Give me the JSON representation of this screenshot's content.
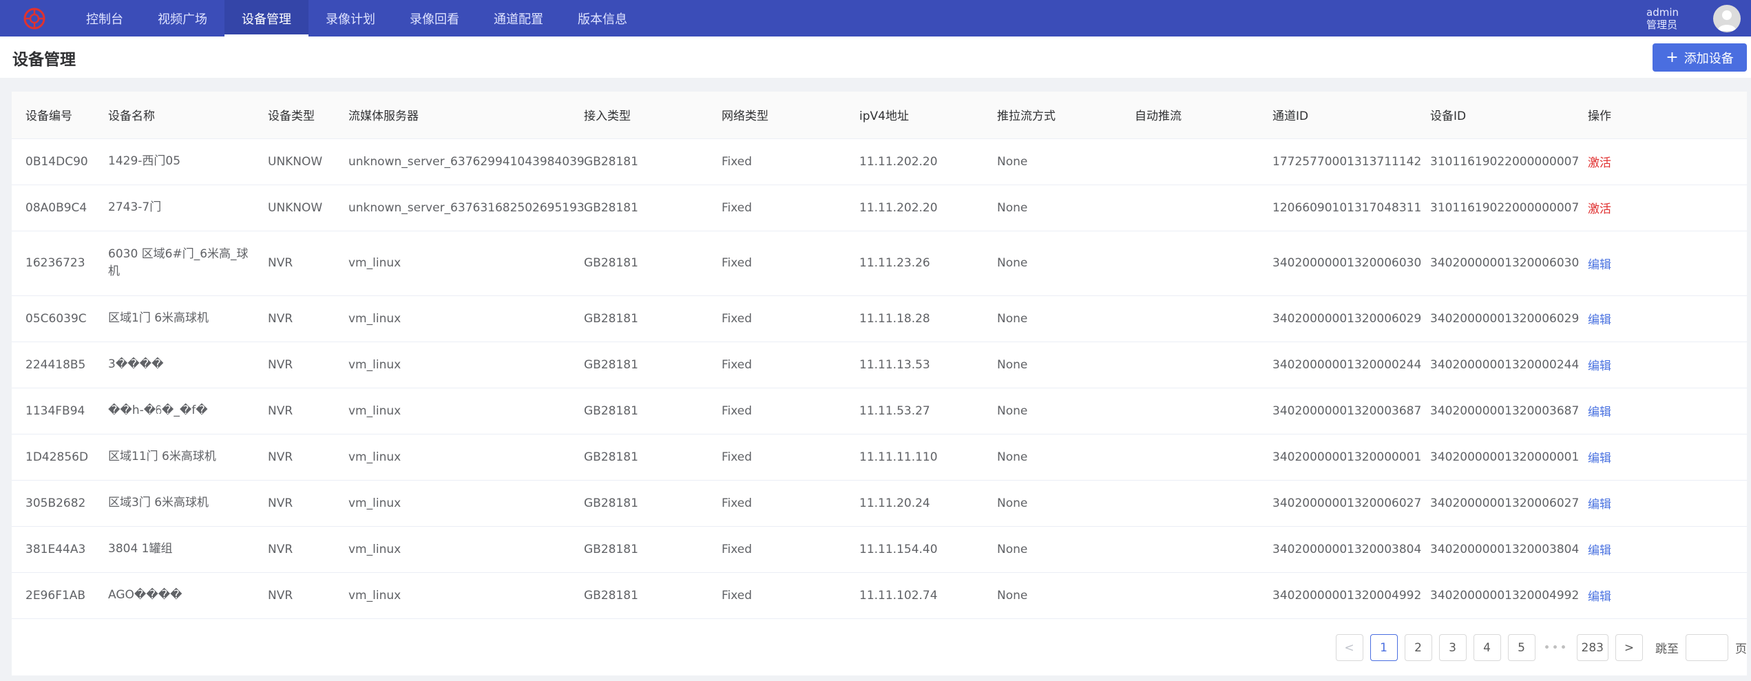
{
  "nav": {
    "items": [
      {
        "label": "控制台"
      },
      {
        "label": "视频广场"
      },
      {
        "label": "设备管理"
      },
      {
        "label": "录像计划"
      },
      {
        "label": "录像回看"
      },
      {
        "label": "通道配置"
      },
      {
        "label": "版本信息"
      }
    ],
    "active_index": 2
  },
  "user": {
    "name": "admin",
    "role": "管理员"
  },
  "page": {
    "title": "设备管理",
    "add_button": "添加设备"
  },
  "table": {
    "columns": [
      "设备编号",
      "设备名称",
      "设备类型",
      "流媒体服务器",
      "接入类型",
      "网络类型",
      "ipV4地址",
      "推拉流方式",
      "自动推流",
      "通道ID",
      "设备ID",
      "操作"
    ],
    "rows": [
      {
        "code": "0B14DC90",
        "name": "1429-西门05",
        "type": "UNKNOW",
        "server": "unknown_server_637629941043984039",
        "access": "GB28181",
        "net": "Fixed",
        "ip": "11.11.202.20",
        "mode": "None",
        "auto": "",
        "channel": "17725770001313711142",
        "device": "31011619022000000007",
        "action": "激活",
        "action_color": "#e02f2f"
      },
      {
        "code": "08A0B9C4",
        "name": "2743-7门",
        "type": "UNKNOW",
        "server": "unknown_server_637631682502695193",
        "access": "GB28181",
        "net": "Fixed",
        "ip": "11.11.202.20",
        "mode": "None",
        "auto": "",
        "channel": "12066090101317048311",
        "device": "31011619022000000007",
        "action": "激活",
        "action_color": "#e02f2f"
      },
      {
        "code": "16236723",
        "name": "6030 区域6#门_6米高_球机",
        "type": "NVR",
        "server": "vm_linux",
        "access": "GB28181",
        "net": "Fixed",
        "ip": "11.11.23.26",
        "mode": "None",
        "auto": "",
        "channel": "34020000001320006030",
        "device": "34020000001320006030",
        "action": "编辑",
        "action_color": "#4a72e0"
      },
      {
        "code": "05C6039C",
        "name": "区域1门 6米高球机",
        "type": "NVR",
        "server": "vm_linux",
        "access": "GB28181",
        "net": "Fixed",
        "ip": "11.11.18.28",
        "mode": "None",
        "auto": "",
        "channel": "34020000001320006029",
        "device": "34020000001320006029",
        "action": "编辑",
        "action_color": "#4a72e0"
      },
      {
        "code": "224418B5",
        "name": "3����",
        "type": "NVR",
        "server": "vm_linux",
        "access": "GB28181",
        "net": "Fixed",
        "ip": "11.11.13.53",
        "mode": "None",
        "auto": "",
        "channel": "34020000001320000244",
        "device": "34020000001320000244",
        "action": "编辑",
        "action_color": "#4a72e0"
      },
      {
        "code": "1134FB94",
        "name": "��h-�ᦆ�_�f�",
        "type": "NVR",
        "server": "vm_linux",
        "access": "GB28181",
        "net": "Fixed",
        "ip": "11.11.53.27",
        "mode": "None",
        "auto": "",
        "channel": "34020000001320003687",
        "device": "34020000001320003687",
        "action": "编辑",
        "action_color": "#4a72e0"
      },
      {
        "code": "1D42856D",
        "name": "区域11门 6米高球机",
        "type": "NVR",
        "server": "vm_linux",
        "access": "GB28181",
        "net": "Fixed",
        "ip": "11.11.11.110",
        "mode": "None",
        "auto": "",
        "channel": "34020000001320000001",
        "device": "34020000001320000001",
        "action": "编辑",
        "action_color": "#4a72e0"
      },
      {
        "code": "305B2682",
        "name": "区域3门 6米高球机",
        "type": "NVR",
        "server": "vm_linux",
        "access": "GB28181",
        "net": "Fixed",
        "ip": "11.11.20.24",
        "mode": "None",
        "auto": "",
        "channel": "34020000001320006027",
        "device": "34020000001320006027",
        "action": "编辑",
        "action_color": "#4a72e0"
      },
      {
        "code": "381E44A3",
        "name": "3804 1罐组",
        "type": "NVR",
        "server": "vm_linux",
        "access": "GB28181",
        "net": "Fixed",
        "ip": "11.11.154.40",
        "mode": "None",
        "auto": "",
        "channel": "34020000001320003804",
        "device": "34020000001320003804",
        "action": "编辑",
        "action_color": "#4a72e0"
      },
      {
        "code": "2E96F1AB",
        "name": "AGO����",
        "type": "NVR",
        "server": "vm_linux",
        "access": "GB28181",
        "net": "Fixed",
        "ip": "11.11.102.74",
        "mode": "None",
        "auto": "",
        "channel": "34020000001320004992",
        "device": "34020000001320004992",
        "action": "编辑",
        "action_color": "#4a72e0"
      }
    ]
  },
  "pagination": {
    "prev": "<",
    "next": ">",
    "pages": [
      "1",
      "2",
      "3",
      "4",
      "5"
    ],
    "current": "1",
    "ellipsis": "•••",
    "last": "283",
    "jump_label": "跳至",
    "jump_suffix": "页"
  },
  "colors": {
    "nav_bg": "#3b4db8",
    "accent": "#4a6ee0",
    "activate": "#e02f2f",
    "edit": "#4a72e0"
  }
}
